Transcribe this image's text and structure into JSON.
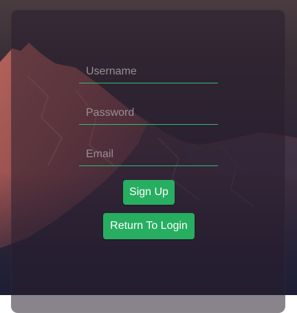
{
  "form": {
    "username_placeholder": "Username",
    "password_placeholder": "Password",
    "email_placeholder": "Email",
    "signup_label": "Sign Up",
    "return_label": "Return To Login"
  },
  "colors": {
    "accent": "#27ae60",
    "field_underline": "#2fbf71"
  },
  "background": {
    "description_icon": "mountain-image"
  }
}
